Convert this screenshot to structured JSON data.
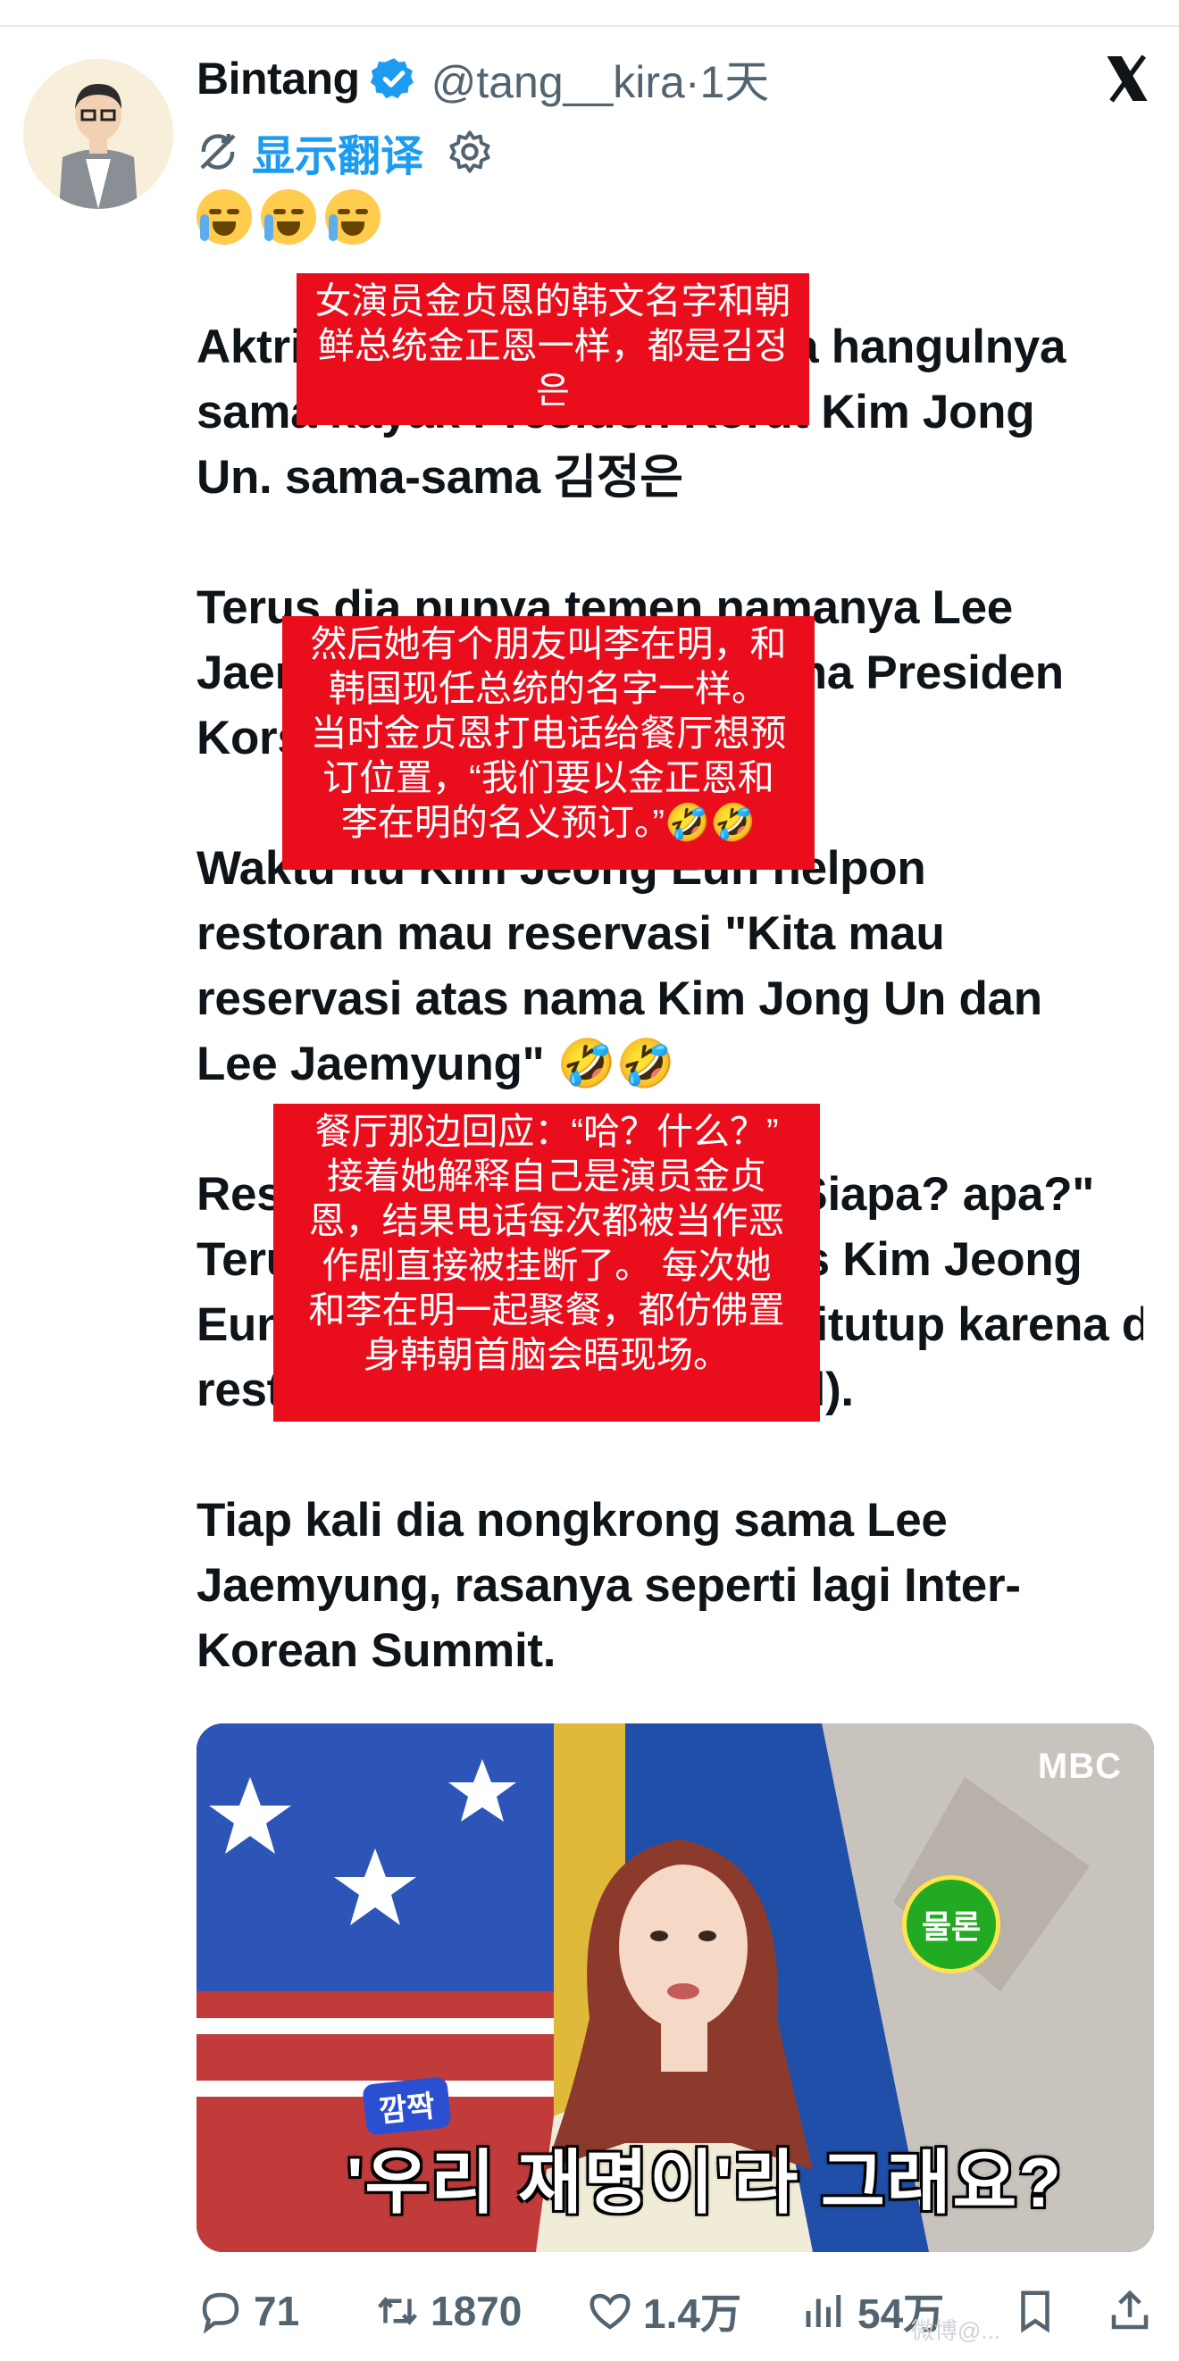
{
  "tweet": {
    "display_name": "Bintang",
    "handle_time": "@tang__kira·1天",
    "translate_label": "显示翻译",
    "emojis": [
      "loudly-crying-face",
      "loudly-crying-face",
      "loudly-crying-face"
    ],
    "paragraphs": [
      [
        "Aktris Kim Jeong Eun nama hangulnya",
        "sama kayak Presiden Korut Kim Jong",
        "Un. sama-sama 김정은"
      ],
      [
        "Terus dia punya temen namanya Lee",
        "Jaemyung, sama kayak nama Presiden",
        "Korsel sekarang."
      ],
      [
        "Waktu itu Kim Jeong Eun nelpon",
        "restoran mau reservasi \"Kita mau",
        "reservasi atas nama Kim Jong Un dan",
        "Lee Jaemyung\" 🤣🤣"
      ],
      [
        "Restorannya bilang \"Hah? Siapa? apa?\"",
        "Terus dia jelasin kalau aktris Kim Jeong",
        "Eun, tapi telponnya selalu ditutup karena dianggap orang iseng tanpa nanya sama",
        "restorannya dikira prank (lol)."
      ],
      [
        "Tiap kali dia nongkrong sama Lee",
        "Jaemyung, rasanya seperti lagi Inter-",
        "Korean Summit."
      ]
    ]
  },
  "annotations": [
    [
      "女演员金贞恩的韩文名字和朝",
      "鲜总统金正恩一样，都是김정",
      "은"
    ],
    [
      "然后她有个朋友叫李在明，和",
      "韩国现任总统的名字一样。",
      "当时金贞恩打电话给餐厅想预",
      "订位置，“我们要以金正恩和",
      "李在明的名义预订。”🤣🤣"
    ],
    [
      "餐厅那边回应：“哈？什么？”",
      "接着她解释自己是演员金贞",
      "恩，结果电话每次都被当作恶",
      "作剧直接被挂断了。 每次她",
      "和李在明一起聚餐，都仿佛置",
      "身韩朝首脑会晤现场。"
    ]
  ],
  "media": {
    "logo": "MBC",
    "badge": "깜짝",
    "caption": "'우리 재명이'라 그래요?",
    "sticker": "물론"
  },
  "actions": {
    "replies": "71",
    "reposts": "1870",
    "likes": "1.4万",
    "views": "54万"
  },
  "watermark": "微博@..."
}
